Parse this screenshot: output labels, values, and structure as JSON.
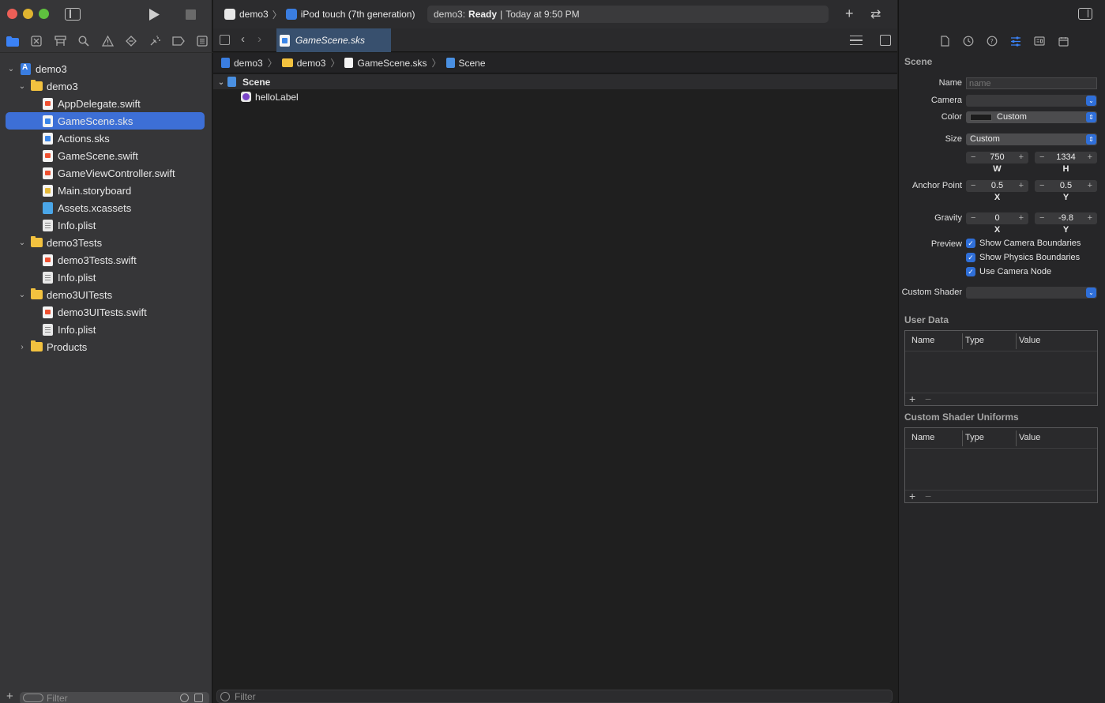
{
  "toolbar": {
    "scheme_app": "demo3",
    "scheme_device": "iPod touch (7th generation)",
    "status_project": "demo3:",
    "status_state": "Ready",
    "status_time": "Today at 9:50 PM"
  },
  "navigator": {
    "filter_placeholder": "Filter",
    "tree": [
      {
        "label": "demo3",
        "type": "project",
        "level": 0,
        "expanded": true
      },
      {
        "label": "demo3",
        "type": "folder",
        "level": 1,
        "expanded": true
      },
      {
        "label": "AppDelegate.swift",
        "type": "swift",
        "level": 2
      },
      {
        "label": "GameScene.sks",
        "type": "sks",
        "level": 2,
        "selected": true
      },
      {
        "label": "Actions.sks",
        "type": "sks",
        "level": 2
      },
      {
        "label": "GameScene.swift",
        "type": "swift",
        "level": 2
      },
      {
        "label": "GameViewController.swift",
        "type": "swift",
        "level": 2
      },
      {
        "label": "Main.storyboard",
        "type": "storyboard",
        "level": 2
      },
      {
        "label": "Assets.xcassets",
        "type": "assets",
        "level": 2
      },
      {
        "label": "Info.plist",
        "type": "plist",
        "level": 2
      },
      {
        "label": "demo3Tests",
        "type": "folder",
        "level": 1,
        "expanded": true
      },
      {
        "label": "demo3Tests.swift",
        "type": "swift",
        "level": 2
      },
      {
        "label": "Info.plist",
        "type": "plist",
        "level": 2
      },
      {
        "label": "demo3UITests",
        "type": "folder",
        "level": 1,
        "expanded": true
      },
      {
        "label": "demo3UITests.swift",
        "type": "swift",
        "level": 2
      },
      {
        "label": "Info.plist",
        "type": "plist",
        "level": 2
      },
      {
        "label": "Products",
        "type": "folder",
        "level": 1,
        "expanded": false
      }
    ]
  },
  "editor": {
    "tab_title": "GameScene.sks",
    "breadcrumb": [
      "demo3",
      "demo3",
      "GameScene.sks",
      "Scene"
    ],
    "outline": {
      "root": "Scene",
      "children": [
        "helloLabel"
      ]
    },
    "filter_placeholder": "Filter"
  },
  "inspector": {
    "section_title": "Scene",
    "name_label": "Name",
    "name_placeholder": "name",
    "camera_label": "Camera",
    "camera_value": "",
    "color_label": "Color",
    "color_value": "Custom",
    "size_label": "Size",
    "size_value": "Custom",
    "size_w": "750",
    "size_h": "1334",
    "w_label": "W",
    "h_label": "H",
    "anchor_label": "Anchor Point",
    "anchor_x": "0.5",
    "anchor_y": "0.5",
    "gravity_label": "Gravity",
    "gravity_x": "0",
    "gravity_y": "-9.8",
    "x_label": "X",
    "y_label": "Y",
    "preview_label": "Preview",
    "preview_options": [
      "Show Camera Boundaries",
      "Show Physics Boundaries",
      "Use Camera Node"
    ],
    "custom_shader_label": "Custom Shader",
    "user_data_title": "User Data",
    "uniforms_title": "Custom Shader Uniforms",
    "table_columns": [
      "Name",
      "Type",
      "Value"
    ]
  }
}
